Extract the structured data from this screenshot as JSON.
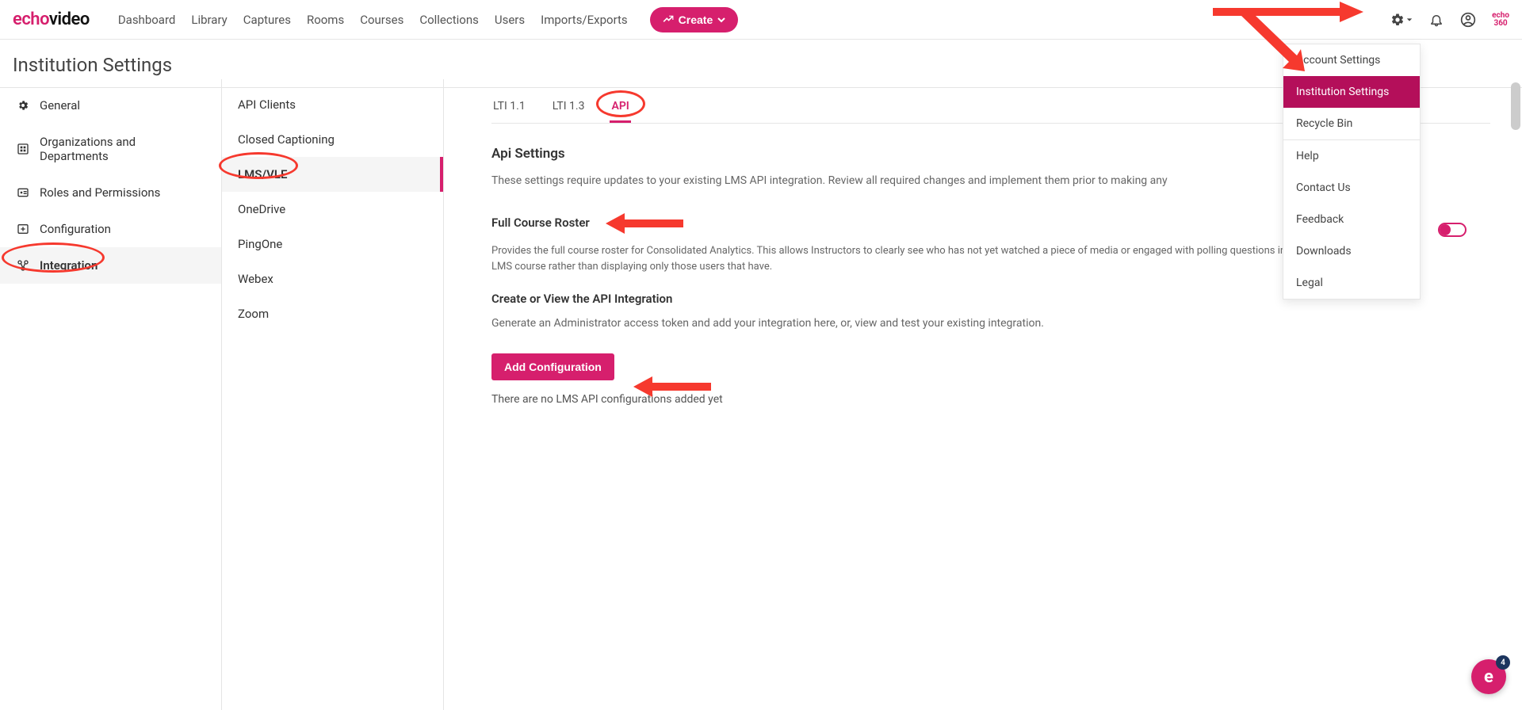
{
  "brand": {
    "part1": "echo",
    "part2": "video"
  },
  "topnav": {
    "items": [
      {
        "label": "Dashboard"
      },
      {
        "label": "Library"
      },
      {
        "label": "Captures"
      },
      {
        "label": "Rooms"
      },
      {
        "label": "Courses"
      },
      {
        "label": "Collections"
      },
      {
        "label": "Users"
      },
      {
        "label": "Imports/Exports"
      }
    ],
    "create_label": "Create"
  },
  "gear_menu": {
    "items": [
      {
        "label": "Account Settings"
      },
      {
        "label": "Institution Settings",
        "highlight": true
      },
      {
        "label": "Recycle Bin"
      }
    ],
    "items2": [
      {
        "label": "Help"
      },
      {
        "label": "Contact Us"
      },
      {
        "label": "Feedback"
      },
      {
        "label": "Downloads"
      },
      {
        "label": "Legal"
      }
    ]
  },
  "page_title": "Institution Settings",
  "sidebar": {
    "items": [
      {
        "label": "General"
      },
      {
        "label": "Organizations and Departments"
      },
      {
        "label": "Roles and Permissions"
      },
      {
        "label": "Configuration"
      },
      {
        "label": "Integration",
        "active": true
      }
    ]
  },
  "subnav": {
    "items": [
      {
        "label": "API Clients"
      },
      {
        "label": "Closed Captioning"
      },
      {
        "label": "LMS/VLE",
        "active": true
      },
      {
        "label": "OneDrive"
      },
      {
        "label": "PingOne"
      },
      {
        "label": "Webex"
      },
      {
        "label": "Zoom"
      }
    ]
  },
  "tabs": {
    "items": [
      {
        "label": "LTI 1.1"
      },
      {
        "label": "LTI 1.3"
      },
      {
        "label": "API",
        "active": true
      }
    ]
  },
  "api": {
    "settings_title": "Api Settings",
    "settings_desc": "These settings require updates to your existing LMS API integration. Review all required changes and implement them prior to making any",
    "roster_title": "Full Course Roster",
    "roster_desc": "Provides the full course roster for Consolidated Analytics. This allows Instructors to clearly see who has not yet watched a piece of media or engaged with polling questions in their LMS course rather than displaying only those users that have.",
    "create_title": "Create or View the API Integration",
    "create_desc": "Generate an Administrator access token and add your integration here, or, view and test your existing integration.",
    "add_btn": "Add Configuration",
    "empty_msg": "There are no LMS API configurations added yet"
  },
  "mini_logo": {
    "line1": "echo",
    "line2": "360"
  },
  "float": {
    "letter": "e",
    "badge": "4"
  }
}
